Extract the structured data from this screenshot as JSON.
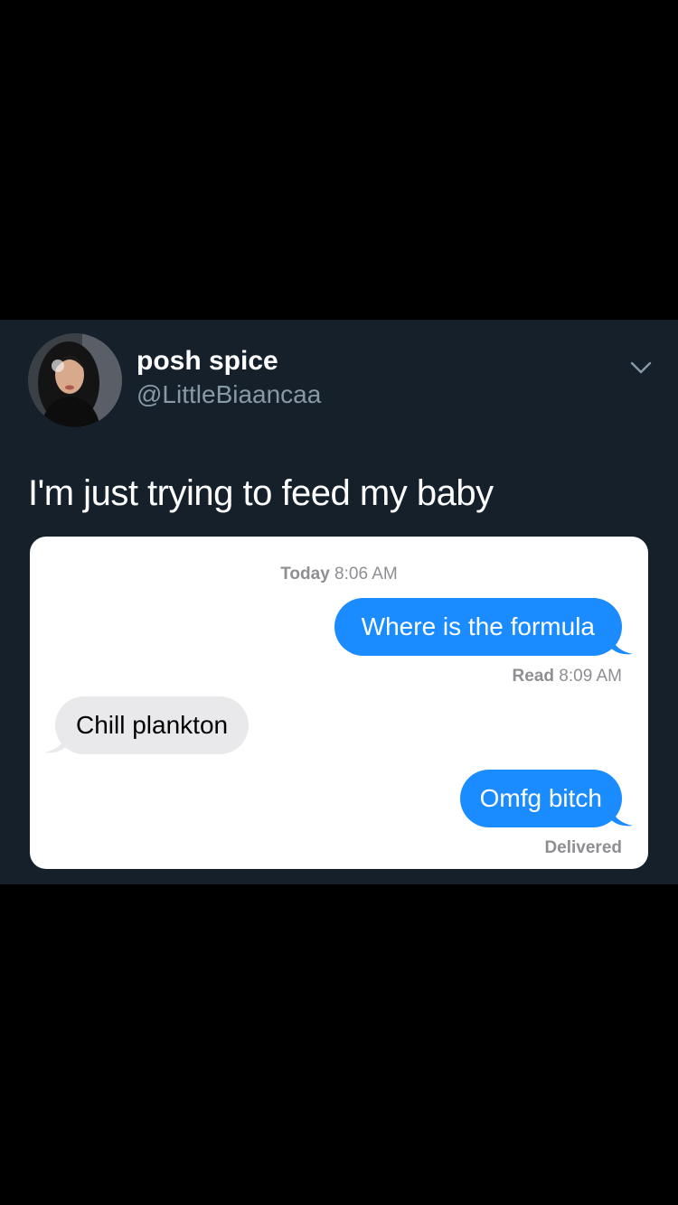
{
  "tweet": {
    "author": {
      "display_name": "posh spice",
      "handle": "@LittleBiaancaa",
      "avatar_icon": "profile-photo"
    },
    "menu_icon": "chevron-down-icon",
    "text": "I'm just trying to feed my baby"
  },
  "conversation": {
    "timestamp_day": "Today",
    "timestamp_time": "8:06 AM",
    "messages": [
      {
        "direction": "sent",
        "text": "Where is the formula"
      },
      {
        "direction": "received",
        "text": "Chill plankton"
      },
      {
        "direction": "sent",
        "text": "Omfg bitch"
      }
    ],
    "read_label": "Read",
    "read_time": "8:09 AM",
    "delivered_label": "Delivered"
  },
  "colors": {
    "tweet_background": "#15202b",
    "page_background": "#000000",
    "imessage_blue": "#1a8cff",
    "received_gray": "#e9e9eb",
    "secondary_text": "#8899a6"
  }
}
